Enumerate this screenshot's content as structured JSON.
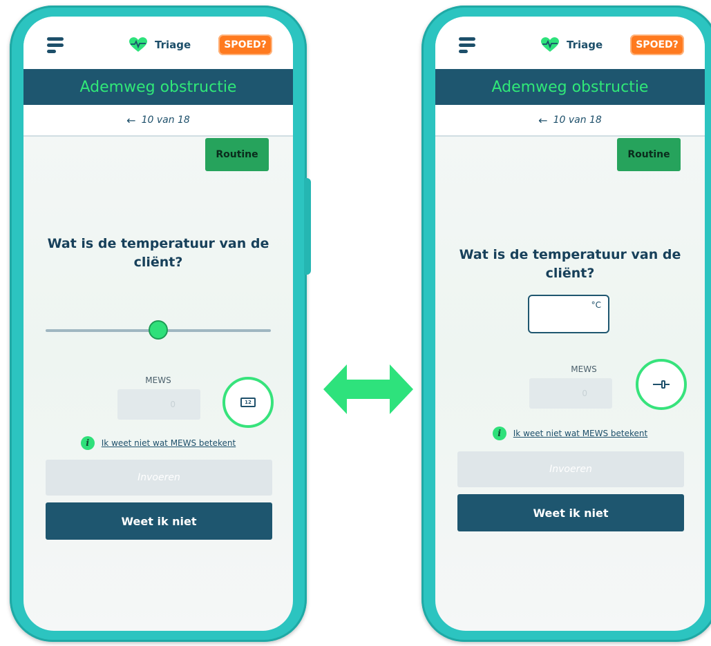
{
  "header": {
    "app_name": "Triage",
    "spoed_label": "SPOED?"
  },
  "title": "Ademweg obstructie",
  "progress": {
    "arrow": "←",
    "text": "10 van 18"
  },
  "routine_label": "Routine",
  "question": "Wat is de temperatuur van de cliënt?",
  "mews": {
    "label": "MEWS",
    "value": "0",
    "info_link": "Ik weet niet wat MEWS betekent"
  },
  "submit_label": "Invoeren",
  "dont_know_label": "Weet ik niet",
  "left_phone": {
    "input_mode": "slider",
    "slider_level": 0.5,
    "toggle_icon": "keyboard-icon",
    "toggle_icon_text": "12"
  },
  "right_phone": {
    "input_mode": "number-field",
    "temperature_value": "",
    "unit": "°C",
    "toggle_icon": "slider-icon"
  },
  "colors": {
    "frame": "#2cc4c0",
    "title_bar": "#1e566f",
    "title_text": "#30e878",
    "spoed": "#ff7a1f",
    "routine": "#26a35c",
    "accent_green": "#37e37c"
  }
}
